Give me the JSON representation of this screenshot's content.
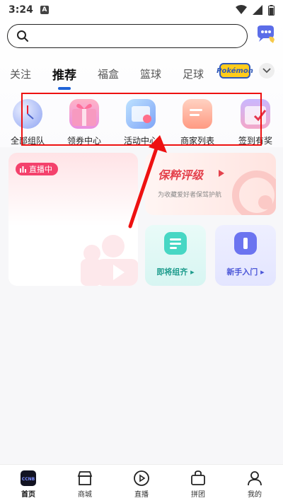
{
  "status_bar": {
    "time": "3:24",
    "notification_letter": "A"
  },
  "search": {
    "placeholder": ""
  },
  "tabs": [
    {
      "label": "关注",
      "active": false
    },
    {
      "label": "推荐",
      "active": true
    },
    {
      "label": "福盒",
      "active": false
    },
    {
      "label": "篮球",
      "active": false
    },
    {
      "label": "足球",
      "active": false
    }
  ],
  "pokemon_logo_text": "Pokémon",
  "categories": [
    {
      "label": "全部组队",
      "icon": "clock-sphere-icon"
    },
    {
      "label": "领券中心",
      "icon": "gift-box-icon"
    },
    {
      "label": "活动中心",
      "icon": "activity-card-icon"
    },
    {
      "label": "商家列表",
      "icon": "folder-list-icon"
    },
    {
      "label": "签到有奖",
      "icon": "calendar-check-icon"
    }
  ],
  "live_card": {
    "badge": "直播中"
  },
  "grade_card": {
    "title": "保粹评级",
    "subtitle": "为收藏爱好者保驾护航"
  },
  "small_cards": [
    {
      "label": "即将组齐 ▸"
    },
    {
      "label": "新手入门 ▸"
    }
  ],
  "bottom_nav": [
    {
      "label": "首页",
      "icon": "ccnb-home-icon",
      "active": true
    },
    {
      "label": "商城",
      "icon": "shop-icon",
      "active": false
    },
    {
      "label": "直播",
      "icon": "live-play-icon",
      "active": false
    },
    {
      "label": "拼团",
      "icon": "group-bag-icon",
      "active": false
    },
    {
      "label": "我的",
      "icon": "profile-icon",
      "active": false
    }
  ],
  "colors": {
    "accent_blue": "#1f63d8",
    "live_red": "#f4416c",
    "grade_red": "#e4424d",
    "annotation_red": "#e11111"
  }
}
